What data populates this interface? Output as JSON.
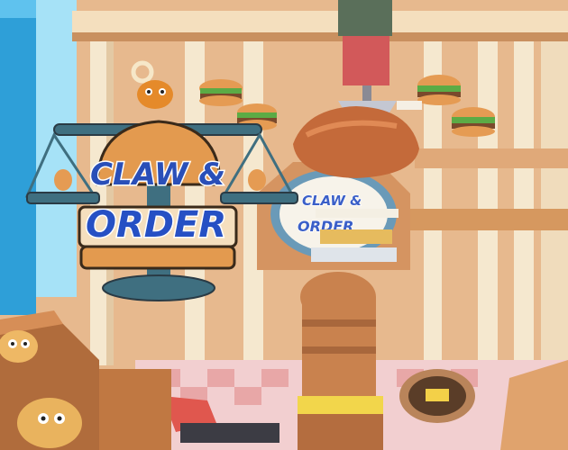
{
  "game": {
    "logo": {
      "line1": "CLAW &",
      "line2": "ORDER"
    },
    "background_sign": {
      "line1": "CLAW &",
      "line2": "ORDER"
    }
  },
  "colors": {
    "wall": "#e7b98e",
    "pillar": "#f3e3c6",
    "shelf": "#d79d6d",
    "bun": "#e39a4f",
    "logo_blue": "#2a4fb8",
    "scale_metal": "#3f6f80",
    "sky_blue": "#5fc2ee",
    "floor_tile_a": "#f2cfd0",
    "floor_tile_b": "#e8a7a7"
  },
  "icons": [
    "claw-head-icon",
    "burger-icon",
    "roast-chicken-icon",
    "scale-icon",
    "coin-icon"
  ]
}
